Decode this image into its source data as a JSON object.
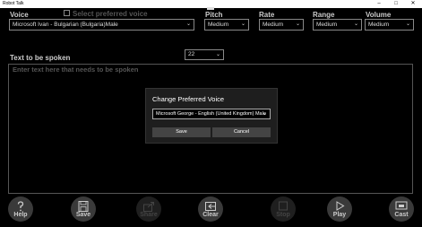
{
  "window": {
    "title": "Robot Talk"
  },
  "voice": {
    "label": "Voice",
    "value": "Microsoft Ivan - Bulgarian (Bulgaria)Male"
  },
  "preferred_voice": {
    "label": "Select preferred voice",
    "checked": false
  },
  "pitch": {
    "label": "Pitch",
    "value": "Medium"
  },
  "rate": {
    "label": "Rate",
    "value": "Medium"
  },
  "range": {
    "label": "Range",
    "value": "Medium"
  },
  "volume": {
    "label": "Volume",
    "value": "Medium"
  },
  "font_size": {
    "value": "22"
  },
  "text_area": {
    "label": "Text to be spoken",
    "placeholder": "Enter text here that needs to be spoken"
  },
  "dialog": {
    "title": "Change Preferred Voice",
    "selected_voice": "Microsoft George - English (United Kingdom) Male",
    "save_label": "Save",
    "cancel_label": "Cancel"
  },
  "bottom_bar": {
    "help": "Help",
    "save": "Save",
    "share": "Share",
    "clear": "Clear",
    "stop": "Stop",
    "play": "Play",
    "cast": "Cast"
  },
  "icons": [
    "question-icon",
    "floppy-disk-icon",
    "share-icon",
    "clear-icon",
    "stop-icon",
    "play-icon",
    "cast-icon",
    "chevron-down-icon"
  ],
  "colors": {
    "background": "#000000",
    "dialog": "#1e1e1e",
    "button": "#3a3a3a"
  }
}
